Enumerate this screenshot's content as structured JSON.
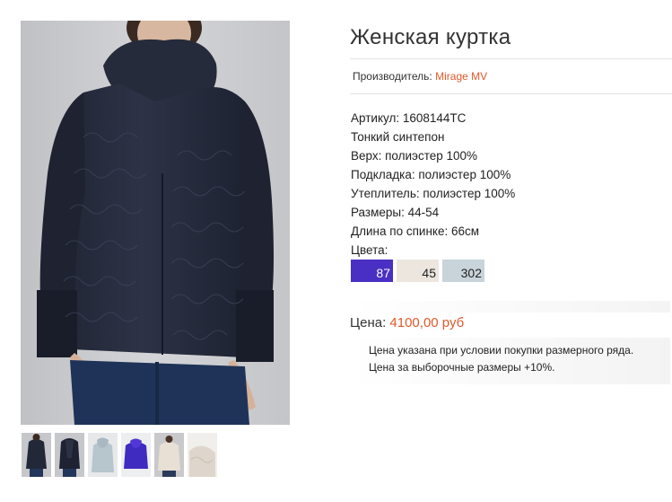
{
  "product": {
    "title": "Женская куртка",
    "manufacturer_label": "Производитель:",
    "manufacturer_name": "Mirage MV"
  },
  "specs": {
    "article": "Артикул: 1608144TC",
    "filling_type": "Тонкий синтепон",
    "outer": "Верх: полиэстер 100%",
    "lining": "Подкладка: полиэстер 100%",
    "insulation": "Утеплитель: полиэстер 100%",
    "sizes": "Размеры: 44-54",
    "back_length": "Длина по спинке: 66см",
    "colors_label": "Цвета:"
  },
  "colors": [
    {
      "code": "87",
      "hex": "#4a2fc4"
    },
    {
      "code": "45",
      "hex": "#ece6df"
    },
    {
      "code": "302",
      "hex": "#c8d4da"
    }
  ],
  "price": {
    "label": "Цена:",
    "value": "4100,00 руб"
  },
  "notes": {
    "line1": "Цена указана при условии покупки размерного ряда.",
    "line2": "Цена за выборочные размеры +10%."
  },
  "accent_color": "#e0592a"
}
